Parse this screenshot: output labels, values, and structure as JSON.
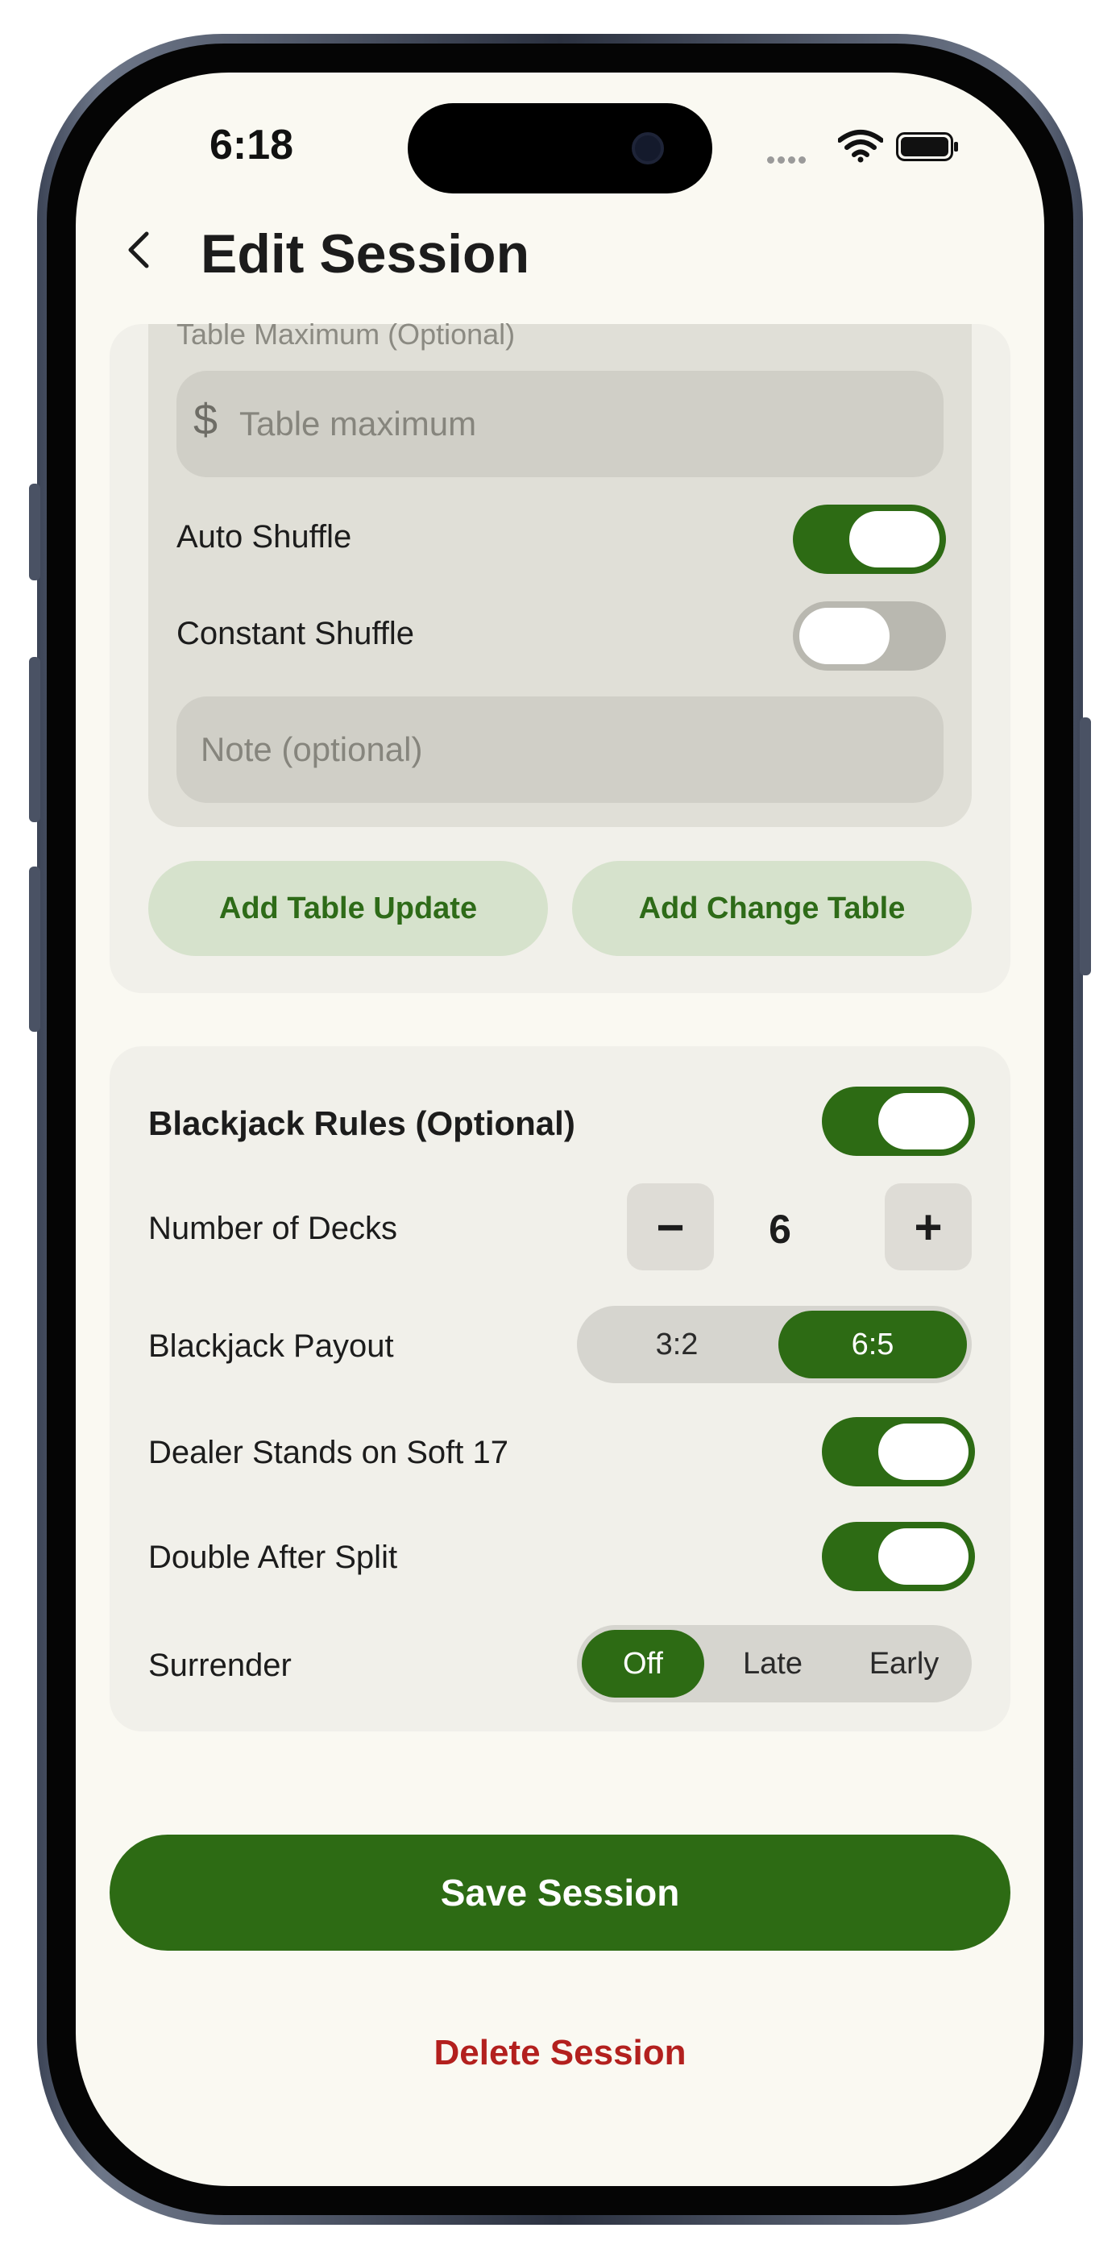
{
  "status_bar": {
    "time": "6:18"
  },
  "nav": {
    "title": "Edit Session",
    "back_icon": "chevron-left-icon"
  },
  "table_section": {
    "max_label": "Table Maximum (Optional)",
    "max_currency": "$",
    "max_placeholder": "Table maximum",
    "auto_shuffle_label": "Auto Shuffle",
    "auto_shuffle_on": true,
    "constant_shuffle_label": "Constant Shuffle",
    "constant_shuffle_on": false,
    "note_placeholder": "Note (optional)",
    "add_update_label": "Add Table Update",
    "add_change_label": "Add Change Table"
  },
  "rules": {
    "title": "Blackjack Rules (Optional)",
    "enabled": true,
    "decks_label": "Number of Decks",
    "decks_minus": "−",
    "decks_value": "6",
    "decks_plus": "+",
    "payout_label": "Blackjack Payout",
    "payout_options": [
      "3:2",
      "6:5"
    ],
    "payout_selected": "6:5",
    "soft17_label": "Dealer Stands on Soft 17",
    "soft17_on": true,
    "das_label": "Double After Split",
    "das_on": true,
    "surrender_label": "Surrender",
    "surrender_options": [
      "Off",
      "Late",
      "Early"
    ],
    "surrender_selected": "Off"
  },
  "actions": {
    "save_label": "Save Session",
    "delete_label": "Delete Session"
  },
  "colors": {
    "accent_green": "#2d6b14",
    "danger_red": "#b3201e",
    "background": "#faf9f2"
  }
}
